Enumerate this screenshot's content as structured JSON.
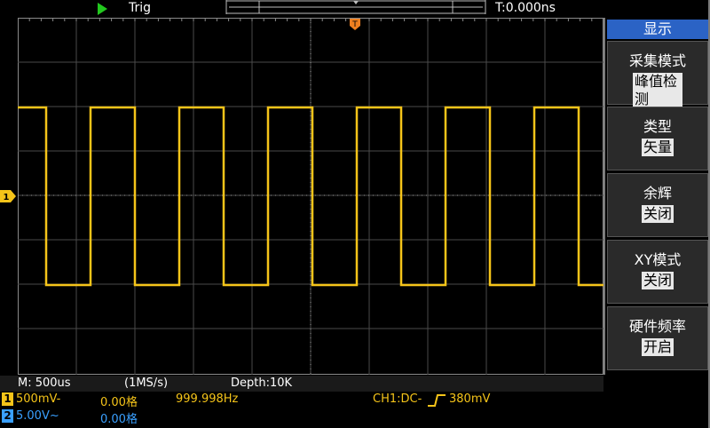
{
  "top": {
    "run_state": "Trig",
    "timebase_offset": "T:0.000ns"
  },
  "menu": {
    "title": "显示",
    "items": [
      {
        "label": "采集模式",
        "value": "峰值检测"
      },
      {
        "label": "类型",
        "value": "矢量"
      },
      {
        "label": "余辉",
        "value": "关闭"
      },
      {
        "label": "XY模式",
        "value": "关闭"
      },
      {
        "label": "硬件频率",
        "value": "开启"
      }
    ]
  },
  "status": {
    "timebase": "M: 500us",
    "sample_rate": "(1MS/s)",
    "depth": "Depth:10K"
  },
  "ch1": {
    "number": "1",
    "scale": "500mV-",
    "offset": "0.00格",
    "frequency": "999.998Hz",
    "trigger_prefix": "CH1:DC-",
    "trigger_level": "380mV",
    "color": "#f5c419"
  },
  "ch2": {
    "number": "2",
    "scale": "5.00V~",
    "offset": "0.00格",
    "color": "#3aa0ff"
  },
  "marker_icons": {
    "run": "play-icon",
    "trigger": "trigger-position-icon",
    "channel": "channel-1-level-icon",
    "edge": "rising-edge-icon"
  }
}
